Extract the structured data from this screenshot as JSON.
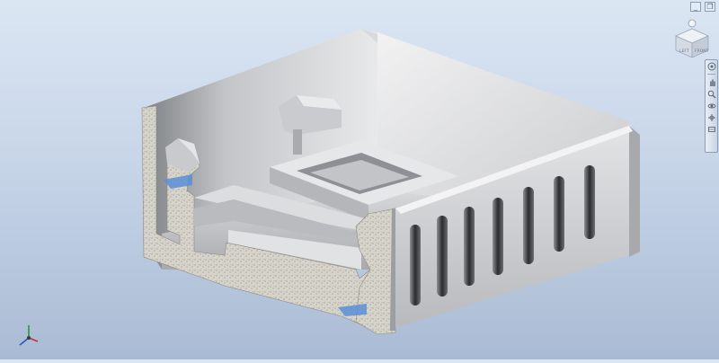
{
  "viewcube": {
    "faces": {
      "left": "LEFT",
      "front": "FRONT"
    }
  },
  "window_controls": {
    "minimize": "_",
    "restore": "❐"
  },
  "navigation_bar": {
    "tools": [
      "steering-wheel",
      "pan",
      "zoom",
      "orbit",
      "look-at",
      "view-face"
    ]
  },
  "colors": {
    "part_body": "#c9cbcd",
    "section_fill": "#d4d2c8",
    "slot_dark": "#2a2a2a",
    "highlight_blue": "#5b8fd6",
    "viewport_top": "#dbe6f3",
    "viewport_bottom": "#a9bbd4"
  },
  "axis_triad": {
    "x": "x",
    "y": "y",
    "z": "z"
  }
}
